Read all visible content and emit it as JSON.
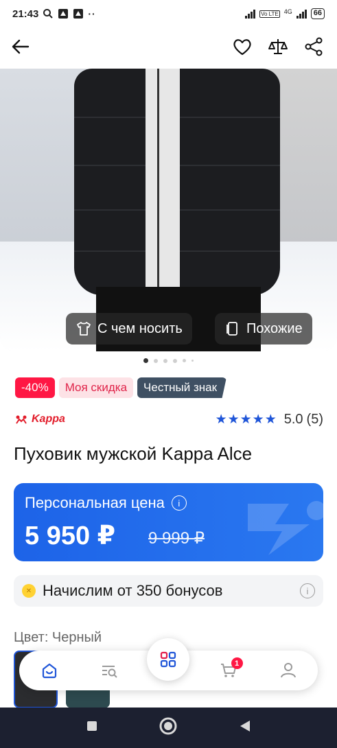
{
  "status_bar": {
    "time": "21:43",
    "battery": "66",
    "network": "4G",
    "volte": "Vo LTE"
  },
  "app_bar": {
    "back_icon": "arrow-left-icon",
    "favorite_icon": "heart-icon",
    "compare_icon": "scales-icon",
    "share_icon": "share-icon"
  },
  "hero": {
    "chips": [
      {
        "label": "С чем носить",
        "icon": "tshirt-icon"
      },
      {
        "label": "Похожие",
        "icon": "cards-icon"
      }
    ],
    "dots_total": 6,
    "dots_active": 0
  },
  "badges": {
    "discount": "-40%",
    "my_discount": "Моя скидка",
    "honest_sign": "Честный знак"
  },
  "brand": {
    "name": "Kappa"
  },
  "rating": {
    "stars": "★★★★★",
    "value": "5.0",
    "count": "(5)"
  },
  "product": {
    "title": "Пуховик мужской Kappa Alce"
  },
  "price": {
    "label": "Персональная цена",
    "current": "5 950 ₽",
    "old": "9 999 ₽"
  },
  "bonus": {
    "text": "Начислим от 350 бонусов"
  },
  "color": {
    "label": "Цвет: Черный",
    "options": [
      "Черный",
      "Темно-зеленый"
    ],
    "selected": "Черный"
  },
  "bottom_nav": {
    "items": [
      "home-icon",
      "search-list-icon",
      "catalog-icon",
      "cart-icon",
      "profile-icon"
    ],
    "cart_count": "1"
  },
  "colors": {
    "accent": "#1f55d8",
    "price_card": "#1d63e8",
    "discount": "#ff1744",
    "honest_sign": "#3f5063",
    "brand": "#e21c2a"
  }
}
